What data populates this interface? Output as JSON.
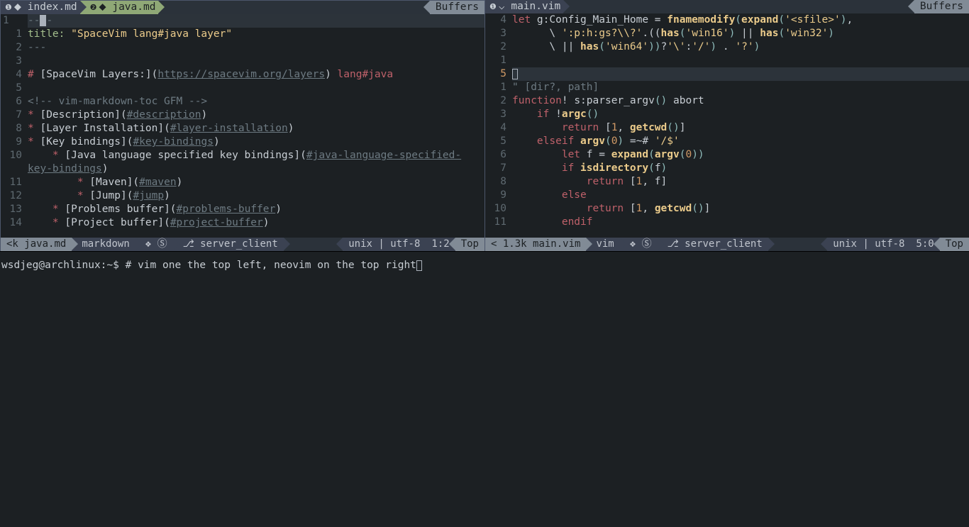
{
  "left": {
    "tabs": [
      {
        "idx": "❶",
        "deco": "⬥",
        "name": "index.md",
        "active": false
      },
      {
        "idx": "❷",
        "deco": "⬥",
        "name": "java.md",
        "active": true
      }
    ],
    "buffers": "Buffers",
    "gutter_label": "1",
    "lines": [
      {
        "n": "",
        "frags": [
          {
            "t": "---",
            "c": "s-dim"
          }
        ],
        "cursorline": true
      },
      {
        "n": "1",
        "frags": [
          {
            "t": "title: ",
            "c": "s-green"
          },
          {
            "t": "\"SpaceVim lang#java layer\"",
            "c": "s-yellow s-str"
          }
        ]
      },
      {
        "n": "2",
        "frags": [
          {
            "t": "---",
            "c": "s-dim"
          }
        ]
      },
      {
        "n": "3",
        "frags": []
      },
      {
        "n": "4",
        "frags": [
          {
            "t": "#",
            "c": "s-red"
          },
          {
            "t": " [",
            "c": ""
          },
          {
            "t": "SpaceVim Layers:",
            "c": ""
          },
          {
            "t": "](",
            "c": ""
          },
          {
            "t": "https://spacevim.org/layers",
            "c": "s-link"
          },
          {
            "t": ") ",
            "c": ""
          },
          {
            "t": "lang#java",
            "c": "s-red"
          }
        ]
      },
      {
        "n": "5",
        "frags": []
      },
      {
        "n": "6",
        "frags": [
          {
            "t": "<!-- vim-markdown-toc GFM -->",
            "c": "s-dim"
          }
        ]
      },
      {
        "n": "7",
        "frags": [
          {
            "t": "*",
            "c": "s-red"
          },
          {
            "t": " [",
            "c": ""
          },
          {
            "t": "Description",
            "c": ""
          },
          {
            "t": "](",
            "c": ""
          },
          {
            "t": "#description",
            "c": "s-link"
          },
          {
            "t": ")",
            "c": ""
          }
        ]
      },
      {
        "n": "8",
        "frags": [
          {
            "t": "*",
            "c": "s-red"
          },
          {
            "t": " [",
            "c": ""
          },
          {
            "t": "Layer Installation",
            "c": ""
          },
          {
            "t": "](",
            "c": ""
          },
          {
            "t": "#layer-installation",
            "c": "s-link"
          },
          {
            "t": ")",
            "c": ""
          }
        ]
      },
      {
        "n": "9",
        "frags": [
          {
            "t": "*",
            "c": "s-red"
          },
          {
            "t": " [",
            "c": ""
          },
          {
            "t": "Key bindings",
            "c": ""
          },
          {
            "t": "](",
            "c": ""
          },
          {
            "t": "#key-bindings",
            "c": "s-link"
          },
          {
            "t": ")",
            "c": ""
          }
        ]
      },
      {
        "n": "10",
        "frags": [
          {
            "t": "    ",
            "c": ""
          },
          {
            "t": "*",
            "c": "s-red"
          },
          {
            "t": " [",
            "c": ""
          },
          {
            "t": "Java language specified key bindings",
            "c": ""
          },
          {
            "t": "](",
            "c": ""
          },
          {
            "t": "#java-language-specified-",
            "c": "s-link"
          }
        ]
      },
      {
        "n": "",
        "frags": [
          {
            "t": "key-bindings",
            "c": "s-link"
          },
          {
            "t": ")",
            "c": ""
          }
        ]
      },
      {
        "n": "11",
        "frags": [
          {
            "t": "        ",
            "c": ""
          },
          {
            "t": "*",
            "c": "s-red"
          },
          {
            "t": " [",
            "c": ""
          },
          {
            "t": "Maven",
            "c": ""
          },
          {
            "t": "](",
            "c": ""
          },
          {
            "t": "#maven",
            "c": "s-link"
          },
          {
            "t": ")",
            "c": ""
          }
        ]
      },
      {
        "n": "12",
        "frags": [
          {
            "t": "        ",
            "c": ""
          },
          {
            "t": "*",
            "c": "s-red"
          },
          {
            "t": " [",
            "c": ""
          },
          {
            "t": "Jump",
            "c": ""
          },
          {
            "t": "](",
            "c": ""
          },
          {
            "t": "#jump",
            "c": "s-link"
          },
          {
            "t": ")",
            "c": ""
          }
        ]
      },
      {
        "n": "13",
        "frags": [
          {
            "t": "    ",
            "c": ""
          },
          {
            "t": "*",
            "c": "s-red"
          },
          {
            "t": " [",
            "c": ""
          },
          {
            "t": "Problems buffer",
            "c": ""
          },
          {
            "t": "](",
            "c": ""
          },
          {
            "t": "#problems-buffer",
            "c": "s-link"
          },
          {
            "t": ")",
            "c": ""
          }
        ]
      },
      {
        "n": "14",
        "frags": [
          {
            "t": "    ",
            "c": ""
          },
          {
            "t": "*",
            "c": "s-red"
          },
          {
            "t": " [",
            "c": ""
          },
          {
            "t": "Project buffer",
            "c": ""
          },
          {
            "t": "](",
            "c": ""
          },
          {
            "t": "#project-buffer",
            "c": "s-link"
          },
          {
            "t": ")",
            "c": ""
          }
        ]
      }
    ],
    "status": {
      "size": "<k",
      "file": "java.md",
      "ft": "markdown",
      "deco": "❖ Ⓢ",
      "branch": "⎇ server_client",
      "enc": "unix | utf-8",
      "pos": "1:2",
      "scroll": "Top"
    }
  },
  "right": {
    "tabs": [
      {
        "idx": "❶",
        "deco": "⌵",
        "name": "main.vim",
        "active": false
      }
    ],
    "buffers": "Buffers",
    "lines": [
      {
        "n": "4",
        "frags": [
          {
            "t": "let ",
            "c": "s-red"
          },
          {
            "t": "g:Config_Main_Home",
            "c": "s-fg"
          },
          {
            "t": " = ",
            "c": ""
          },
          {
            "t": "fnamemodify",
            "c": "s-func"
          },
          {
            "t": "(",
            "c": "s-paren"
          },
          {
            "t": "expand",
            "c": "s-func"
          },
          {
            "t": "(",
            "c": "s-paren"
          },
          {
            "t": "'<sfile>'",
            "c": "s-str"
          },
          {
            "t": ")",
            "c": "s-paren"
          },
          {
            "t": ",",
            "c": ""
          }
        ]
      },
      {
        "n": "3",
        "frags": [
          {
            "t": "      \\ ",
            "c": ""
          },
          {
            "t": "':p:h:gs?\\\\?'",
            "c": "s-str"
          },
          {
            "t": ".((",
            "c": ""
          },
          {
            "t": "has",
            "c": "s-func"
          },
          {
            "t": "(",
            "c": "s-paren"
          },
          {
            "t": "'win16'",
            "c": "s-str"
          },
          {
            "t": ")",
            "c": "s-paren"
          },
          {
            "t": " || ",
            "c": ""
          },
          {
            "t": "has",
            "c": "s-func"
          },
          {
            "t": "(",
            "c": "s-paren"
          },
          {
            "t": "'win32'",
            "c": "s-str"
          },
          {
            "t": ")",
            "c": "s-paren"
          }
        ]
      },
      {
        "n": "2",
        "frags": [
          {
            "t": "      \\ || ",
            "c": ""
          },
          {
            "t": "has",
            "c": "s-func"
          },
          {
            "t": "(",
            "c": "s-paren"
          },
          {
            "t": "'win64'",
            "c": "s-str"
          },
          {
            "t": "))",
            "c": "s-paren"
          },
          {
            "t": "?",
            "c": ""
          },
          {
            "t": "'\\'",
            "c": "s-str"
          },
          {
            "t": ":",
            "c": ""
          },
          {
            "t": "'/'",
            "c": "s-str"
          },
          {
            "t": ")",
            "c": "s-paren"
          },
          {
            "t": " . ",
            "c": ""
          },
          {
            "t": "'?'",
            "c": "s-str"
          },
          {
            "t": ")",
            "c": "s-paren"
          }
        ]
      },
      {
        "n": "1",
        "frags": []
      },
      {
        "n": "5",
        "frags": [],
        "cursorline": true,
        "cursor": true,
        "cur": true
      },
      {
        "n": "1",
        "frags": [
          {
            "t": "\" [dir?, path]",
            "c": "s-dim"
          }
        ]
      },
      {
        "n": "2",
        "frags": [
          {
            "t": "function",
            "c": "s-red"
          },
          {
            "t": "! ",
            "c": ""
          },
          {
            "t": "s:parser_argv",
            "c": "s-fg"
          },
          {
            "t": "()",
            "c": "s-paren"
          },
          {
            "t": " abort",
            "c": ""
          }
        ]
      },
      {
        "n": "3",
        "frags": [
          {
            "t": "    ",
            "c": ""
          },
          {
            "t": "if ",
            "c": "s-red"
          },
          {
            "t": "!",
            "c": ""
          },
          {
            "t": "argc",
            "c": "s-func"
          },
          {
            "t": "()",
            "c": "s-paren"
          }
        ]
      },
      {
        "n": "4",
        "frags": [
          {
            "t": "        ",
            "c": ""
          },
          {
            "t": "return ",
            "c": "s-red"
          },
          {
            "t": "[",
            "c": ""
          },
          {
            "t": "1",
            "c": "s-orange"
          },
          {
            "t": ", ",
            "c": ""
          },
          {
            "t": "getcwd",
            "c": "s-func"
          },
          {
            "t": "()",
            "c": "s-paren"
          },
          {
            "t": "]",
            "c": ""
          }
        ]
      },
      {
        "n": "5",
        "frags": [
          {
            "t": "    ",
            "c": ""
          },
          {
            "t": "elseif ",
            "c": "s-red"
          },
          {
            "t": "argv",
            "c": "s-func"
          },
          {
            "t": "(",
            "c": "s-paren"
          },
          {
            "t": "0",
            "c": "s-orange"
          },
          {
            "t": ")",
            "c": "s-paren"
          },
          {
            "t": " =~# ",
            "c": ""
          },
          {
            "t": "'/$'",
            "c": "s-str"
          }
        ]
      },
      {
        "n": "6",
        "frags": [
          {
            "t": "        ",
            "c": ""
          },
          {
            "t": "let ",
            "c": "s-red"
          },
          {
            "t": "f = ",
            "c": ""
          },
          {
            "t": "expand",
            "c": "s-func"
          },
          {
            "t": "(",
            "c": "s-paren"
          },
          {
            "t": "argv",
            "c": "s-func"
          },
          {
            "t": "(",
            "c": "s-paren"
          },
          {
            "t": "0",
            "c": "s-orange"
          },
          {
            "t": "))",
            "c": "s-paren"
          }
        ]
      },
      {
        "n": "7",
        "frags": [
          {
            "t": "        ",
            "c": ""
          },
          {
            "t": "if ",
            "c": "s-red"
          },
          {
            "t": "isdirectory",
            "c": "s-func"
          },
          {
            "t": "(",
            "c": "s-paren"
          },
          {
            "t": "f",
            "c": ""
          },
          {
            "t": ")",
            "c": "s-paren"
          }
        ]
      },
      {
        "n": "8",
        "frags": [
          {
            "t": "            ",
            "c": ""
          },
          {
            "t": "return ",
            "c": "s-red"
          },
          {
            "t": "[",
            "c": ""
          },
          {
            "t": "1",
            "c": "s-orange"
          },
          {
            "t": ", f]",
            "c": ""
          }
        ]
      },
      {
        "n": "9",
        "frags": [
          {
            "t": "        ",
            "c": ""
          },
          {
            "t": "else",
            "c": "s-red"
          }
        ]
      },
      {
        "n": "10",
        "frags": [
          {
            "t": "            ",
            "c": ""
          },
          {
            "t": "return ",
            "c": "s-red"
          },
          {
            "t": "[",
            "c": ""
          },
          {
            "t": "1",
            "c": "s-orange"
          },
          {
            "t": ", ",
            "c": ""
          },
          {
            "t": "getcwd",
            "c": "s-func"
          },
          {
            "t": "()",
            "c": "s-paren"
          },
          {
            "t": "]",
            "c": ""
          }
        ]
      },
      {
        "n": "11",
        "frags": [
          {
            "t": "        ",
            "c": ""
          },
          {
            "t": "endif",
            "c": "s-red"
          }
        ]
      }
    ],
    "status": {
      "size": "< 1.3k",
      "file": "main.vim",
      "ft": "vim",
      "deco": "❖ Ⓢ",
      "branch": "⎇ server_client",
      "enc": "unix | utf-8",
      "pos": "5:0",
      "scroll": "Top"
    }
  },
  "terminal": {
    "prompt": "wsdjeg@archlinux:~$",
    "text": " # vim one the top left, neovim on the top right"
  }
}
